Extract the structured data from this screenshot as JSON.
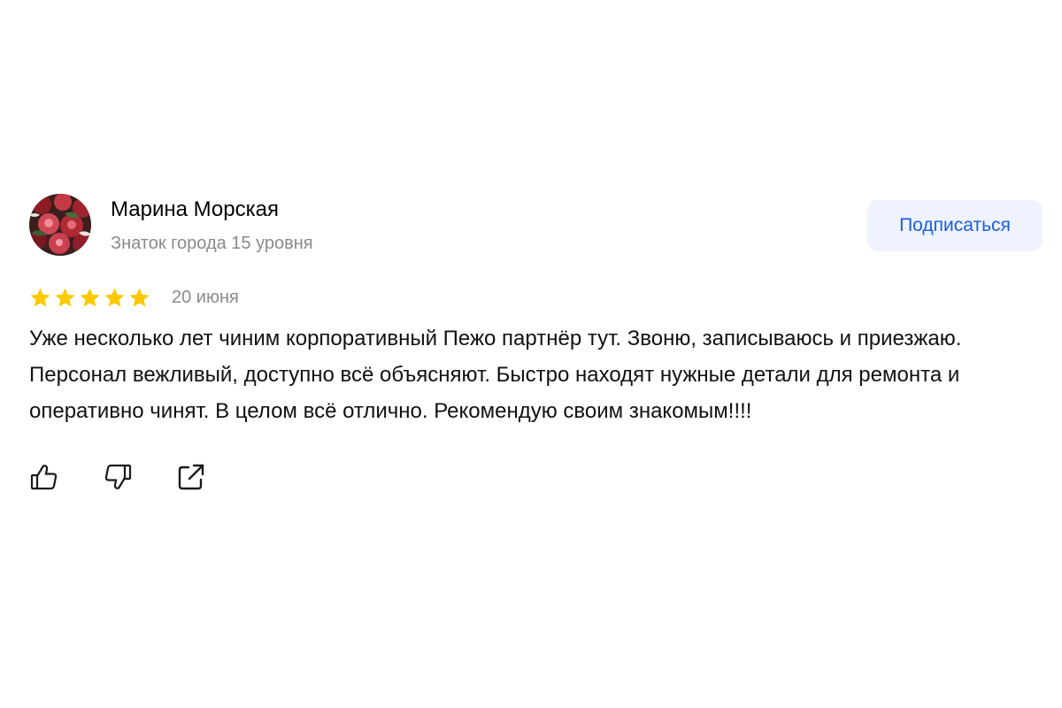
{
  "review": {
    "author": {
      "name": "Марина Морская",
      "level": "Знаток города 15 уровня",
      "avatar_icon": "rose-bouquet-avatar"
    },
    "subscribe_label": "Подписаться",
    "rating": {
      "value": 5,
      "max": 5,
      "star_color": "#fcc900"
    },
    "date": "20 июня",
    "text": "Уже несколько лет чиним корпоративный Пежо партнёр тут. Звоню, записываюсь и приезжаю. Персонал вежливый, доступно всё объясняют. Быстро находят нужные детали для ремонта и оперативно чинят. В целом всё отлично. Рекомендую своим знакомым!!!!",
    "actions": [
      "thumbs-up-icon",
      "thumbs-down-icon",
      "share-icon"
    ]
  },
  "colors": {
    "accent": "#1a5fe0",
    "button_bg": "#eef3fd",
    "secondary_text": "#8a8a8a"
  }
}
